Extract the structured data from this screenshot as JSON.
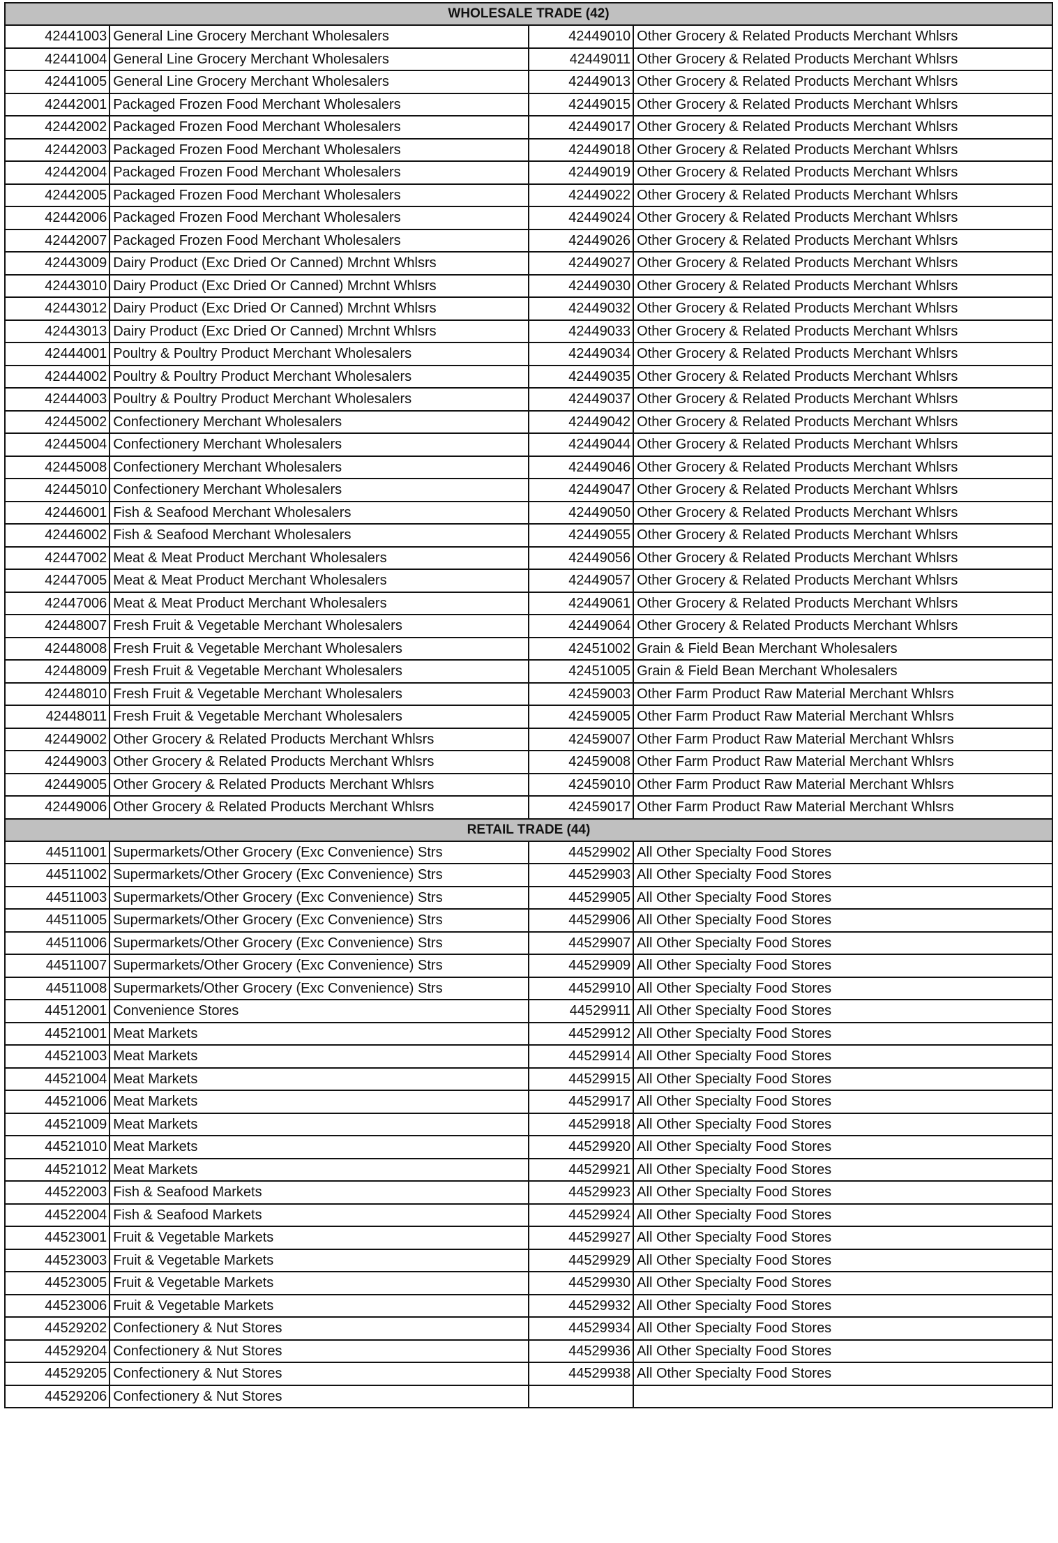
{
  "sections": [
    {
      "title": "WHOLESALE TRADE (42)",
      "left": [
        [
          "42441003",
          "General Line Grocery Merchant Wholesalers"
        ],
        [
          "42441004",
          "General Line Grocery Merchant Wholesalers"
        ],
        [
          "42441005",
          "General Line Grocery Merchant Wholesalers"
        ],
        [
          "42442001",
          "Packaged Frozen Food Merchant Wholesalers"
        ],
        [
          "42442002",
          "Packaged Frozen Food Merchant Wholesalers"
        ],
        [
          "42442003",
          "Packaged Frozen Food Merchant Wholesalers"
        ],
        [
          "42442004",
          "Packaged Frozen Food Merchant Wholesalers"
        ],
        [
          "42442005",
          "Packaged Frozen Food Merchant Wholesalers"
        ],
        [
          "42442006",
          "Packaged Frozen Food Merchant Wholesalers"
        ],
        [
          "42442007",
          "Packaged Frozen Food Merchant Wholesalers"
        ],
        [
          "42443009",
          "Dairy Product (Exc Dried Or Canned) Mrchnt Whlsrs"
        ],
        [
          "42443010",
          "Dairy Product (Exc Dried Or Canned) Mrchnt Whlsrs"
        ],
        [
          "42443012",
          "Dairy Product (Exc Dried Or Canned) Mrchnt Whlsrs"
        ],
        [
          "42443013",
          "Dairy Product (Exc Dried Or Canned) Mrchnt Whlsrs"
        ],
        [
          "42444001",
          "Poultry & Poultry Product Merchant Wholesalers"
        ],
        [
          "42444002",
          "Poultry & Poultry Product Merchant Wholesalers"
        ],
        [
          "42444003",
          "Poultry & Poultry Product Merchant Wholesalers"
        ],
        [
          "42445002",
          "Confectionery Merchant Wholesalers"
        ],
        [
          "42445004",
          "Confectionery Merchant Wholesalers"
        ],
        [
          "42445008",
          "Confectionery Merchant Wholesalers"
        ],
        [
          "42445010",
          "Confectionery Merchant Wholesalers"
        ],
        [
          "42446001",
          "Fish & Seafood Merchant Wholesalers"
        ],
        [
          "42446002",
          "Fish & Seafood Merchant Wholesalers"
        ],
        [
          "42447002",
          "Meat & Meat Product Merchant Wholesalers"
        ],
        [
          "42447005",
          "Meat & Meat Product Merchant Wholesalers"
        ],
        [
          "42447006",
          "Meat & Meat Product Merchant Wholesalers"
        ],
        [
          "42448007",
          "Fresh Fruit & Vegetable Merchant Wholesalers"
        ],
        [
          "42448008",
          "Fresh Fruit & Vegetable Merchant Wholesalers"
        ],
        [
          "42448009",
          "Fresh Fruit & Vegetable Merchant Wholesalers"
        ],
        [
          "42448010",
          "Fresh Fruit & Vegetable Merchant Wholesalers"
        ],
        [
          "42448011",
          "Fresh Fruit & Vegetable Merchant Wholesalers"
        ],
        [
          "42449002",
          "Other Grocery & Related Products Merchant Whlsrs"
        ],
        [
          "42449003",
          "Other Grocery & Related Products Merchant Whlsrs"
        ],
        [
          "42449005",
          "Other Grocery & Related Products Merchant Whlsrs"
        ],
        [
          "42449006",
          "Other Grocery & Related Products Merchant Whlsrs"
        ]
      ],
      "right": [
        [
          "42449010",
          "Other Grocery & Related Products Merchant Whlsrs"
        ],
        [
          "42449011",
          "Other Grocery & Related Products Merchant Whlsrs"
        ],
        [
          "42449013",
          "Other Grocery & Related Products Merchant Whlsrs"
        ],
        [
          "42449015",
          "Other Grocery & Related Products Merchant Whlsrs"
        ],
        [
          "42449017",
          "Other Grocery & Related Products Merchant Whlsrs"
        ],
        [
          "42449018",
          "Other Grocery & Related Products Merchant Whlsrs"
        ],
        [
          "42449019",
          "Other Grocery & Related Products Merchant Whlsrs"
        ],
        [
          "42449022",
          "Other Grocery & Related Products Merchant Whlsrs"
        ],
        [
          "42449024",
          "Other Grocery & Related Products Merchant Whlsrs"
        ],
        [
          "42449026",
          "Other Grocery & Related Products Merchant Whlsrs"
        ],
        [
          "42449027",
          "Other Grocery & Related Products Merchant Whlsrs"
        ],
        [
          "42449030",
          "Other Grocery & Related Products Merchant Whlsrs"
        ],
        [
          "42449032",
          "Other Grocery & Related Products Merchant Whlsrs"
        ],
        [
          "42449033",
          "Other Grocery & Related Products Merchant Whlsrs"
        ],
        [
          "42449034",
          "Other Grocery & Related Products Merchant Whlsrs"
        ],
        [
          "42449035",
          "Other Grocery & Related Products Merchant Whlsrs"
        ],
        [
          "42449037",
          "Other Grocery & Related Products Merchant Whlsrs"
        ],
        [
          "42449042",
          "Other Grocery & Related Products Merchant Whlsrs"
        ],
        [
          "42449044",
          "Other Grocery & Related Products Merchant Whlsrs"
        ],
        [
          "42449046",
          "Other Grocery & Related Products Merchant Whlsrs"
        ],
        [
          "42449047",
          "Other Grocery & Related Products Merchant Whlsrs"
        ],
        [
          "42449050",
          "Other Grocery & Related Products Merchant Whlsrs"
        ],
        [
          "42449055",
          "Other Grocery & Related Products Merchant Whlsrs"
        ],
        [
          "42449056",
          "Other Grocery & Related Products Merchant Whlsrs"
        ],
        [
          "42449057",
          "Other Grocery & Related Products Merchant Whlsrs"
        ],
        [
          "42449061",
          "Other Grocery & Related Products Merchant Whlsrs"
        ],
        [
          "42449064",
          "Other Grocery & Related Products Merchant Whlsrs"
        ],
        [
          "42451002",
          "Grain & Field Bean Merchant Wholesalers"
        ],
        [
          "42451005",
          "Grain & Field Bean Merchant Wholesalers"
        ],
        [
          "42459003",
          "Other Farm Product Raw Material Merchant Whlsrs"
        ],
        [
          "42459005",
          "Other Farm Product Raw Material Merchant Whlsrs"
        ],
        [
          "42459007",
          "Other Farm Product Raw Material Merchant Whlsrs"
        ],
        [
          "42459008",
          "Other Farm Product Raw Material Merchant Whlsrs"
        ],
        [
          "42459010",
          "Other Farm Product Raw Material Merchant Whlsrs"
        ],
        [
          "42459017",
          "Other Farm Product Raw Material Merchant Whlsrs"
        ]
      ]
    },
    {
      "title": "RETAIL TRADE (44)",
      "left": [
        [
          "44511001",
          "Supermarkets/Other Grocery (Exc Convenience) Strs"
        ],
        [
          "44511002",
          "Supermarkets/Other Grocery (Exc Convenience) Strs"
        ],
        [
          "44511003",
          "Supermarkets/Other Grocery (Exc Convenience) Strs"
        ],
        [
          "44511005",
          "Supermarkets/Other Grocery (Exc Convenience) Strs"
        ],
        [
          "44511006",
          "Supermarkets/Other Grocery (Exc Convenience) Strs"
        ],
        [
          "44511007",
          "Supermarkets/Other Grocery (Exc Convenience) Strs"
        ],
        [
          "44511008",
          "Supermarkets/Other Grocery (Exc Convenience) Strs"
        ],
        [
          "44512001",
          "Convenience Stores"
        ],
        [
          "44521001",
          "Meat Markets"
        ],
        [
          "44521003",
          "Meat Markets"
        ],
        [
          "44521004",
          "Meat Markets"
        ],
        [
          "44521006",
          "Meat Markets"
        ],
        [
          "44521009",
          "Meat Markets"
        ],
        [
          "44521010",
          "Meat Markets"
        ],
        [
          "44521012",
          "Meat Markets"
        ],
        [
          "44522003",
          "Fish & Seafood Markets"
        ],
        [
          "44522004",
          "Fish & Seafood Markets"
        ],
        [
          "44523001",
          "Fruit & Vegetable Markets"
        ],
        [
          "44523003",
          "Fruit & Vegetable Markets"
        ],
        [
          "44523005",
          "Fruit & Vegetable Markets"
        ],
        [
          "44523006",
          "Fruit & Vegetable Markets"
        ],
        [
          "44529202",
          "Confectionery & Nut Stores"
        ],
        [
          "44529204",
          "Confectionery & Nut Stores"
        ],
        [
          "44529205",
          "Confectionery & Nut Stores"
        ],
        [
          "44529206",
          "Confectionery & Nut Stores"
        ]
      ],
      "right": [
        [
          "44529902",
          "All Other Specialty Food Stores"
        ],
        [
          "44529903",
          "All Other Specialty Food Stores"
        ],
        [
          "44529905",
          "All Other Specialty Food Stores"
        ],
        [
          "44529906",
          "All Other Specialty Food Stores"
        ],
        [
          "44529907",
          "All Other Specialty Food Stores"
        ],
        [
          "44529909",
          "All Other Specialty Food Stores"
        ],
        [
          "44529910",
          "All Other Specialty Food Stores"
        ],
        [
          "44529911",
          "All Other Specialty Food Stores"
        ],
        [
          "44529912",
          "All Other Specialty Food Stores"
        ],
        [
          "44529914",
          "All Other Specialty Food Stores"
        ],
        [
          "44529915",
          "All Other Specialty Food Stores"
        ],
        [
          "44529917",
          "All Other Specialty Food Stores"
        ],
        [
          "44529918",
          "All Other Specialty Food Stores"
        ],
        [
          "44529920",
          "All Other Specialty Food Stores"
        ],
        [
          "44529921",
          "All Other Specialty Food Stores"
        ],
        [
          "44529923",
          "All Other Specialty Food Stores"
        ],
        [
          "44529924",
          "All Other Specialty Food Stores"
        ],
        [
          "44529927",
          "All Other Specialty Food Stores"
        ],
        [
          "44529929",
          "All Other Specialty Food Stores"
        ],
        [
          "44529930",
          "All Other Specialty Food Stores"
        ],
        [
          "44529932",
          "All Other Specialty Food Stores"
        ],
        [
          "44529934",
          "All Other Specialty Food Stores"
        ],
        [
          "44529936",
          "All Other Specialty Food Stores"
        ],
        [
          "44529938",
          "All Other Specialty Food Stores"
        ]
      ]
    }
  ]
}
